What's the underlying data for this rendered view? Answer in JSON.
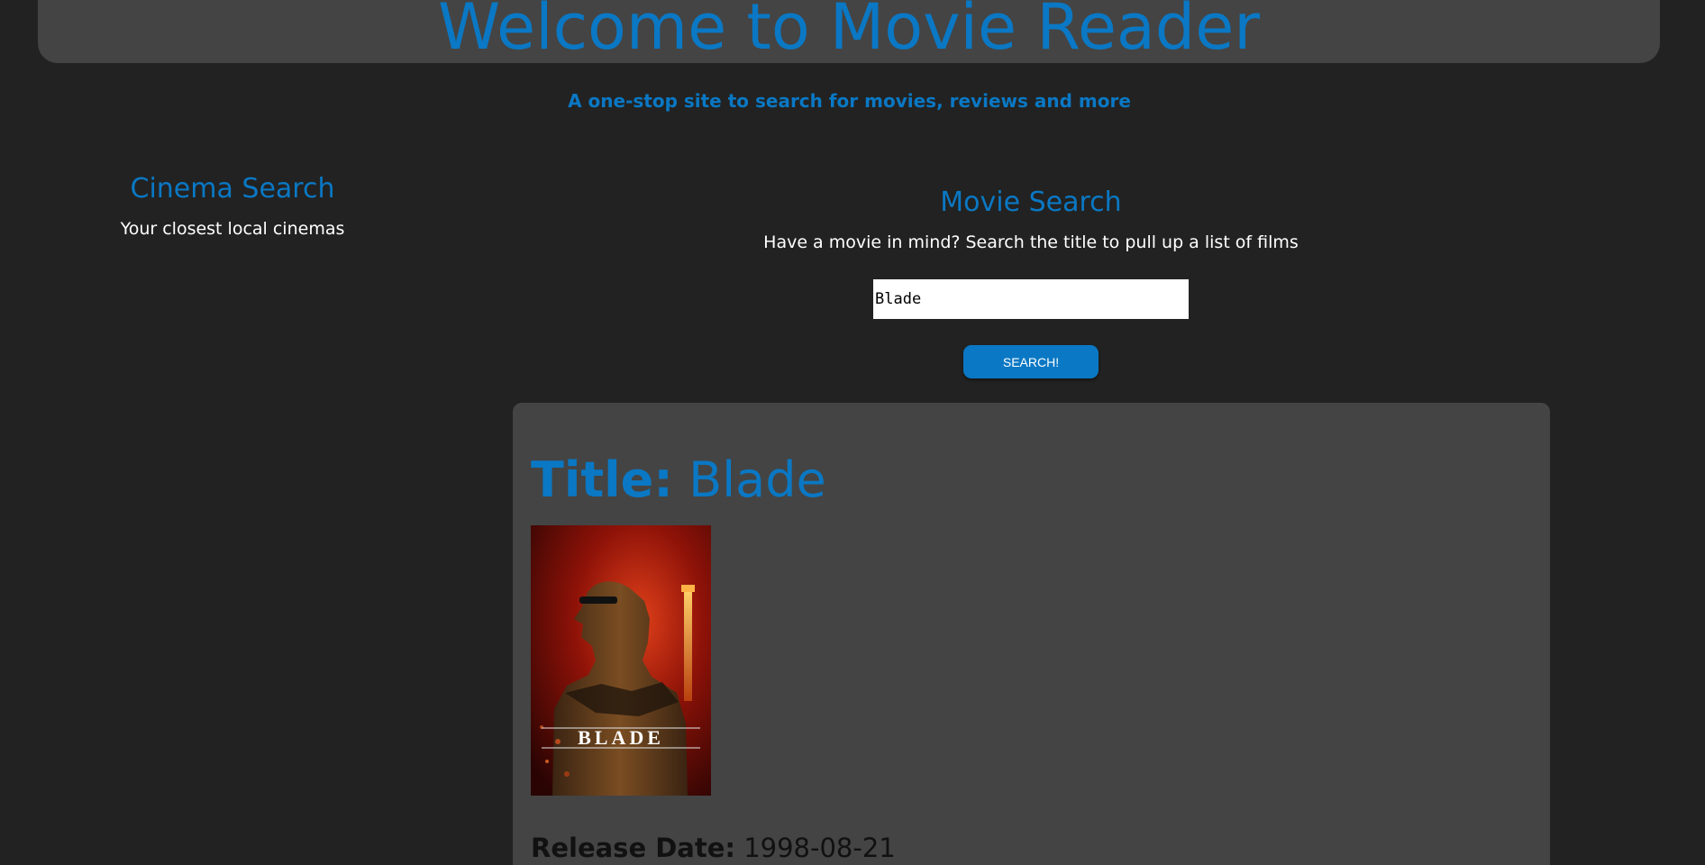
{
  "header": {
    "title": "Welcome to Movie Reader",
    "tagline": "A one-stop site to search for movies, reviews and more"
  },
  "cinema_search": {
    "title": "Cinema Search",
    "subtitle": "Your closest local cinemas"
  },
  "movie_search": {
    "title": "Movie Search",
    "subtitle": "Have a movie in mind? Search the title to pull up a list of films",
    "input_value": "Blade",
    "button_label": "SEARCH!"
  },
  "result": {
    "title_label": "Title:",
    "title_value": "Blade",
    "poster_text": "BLADE",
    "release_label": "Release Date:",
    "release_value": "1998-08-21"
  },
  "colors": {
    "background": "#222222",
    "panel": "#444444",
    "accent": "#0a78c4"
  }
}
